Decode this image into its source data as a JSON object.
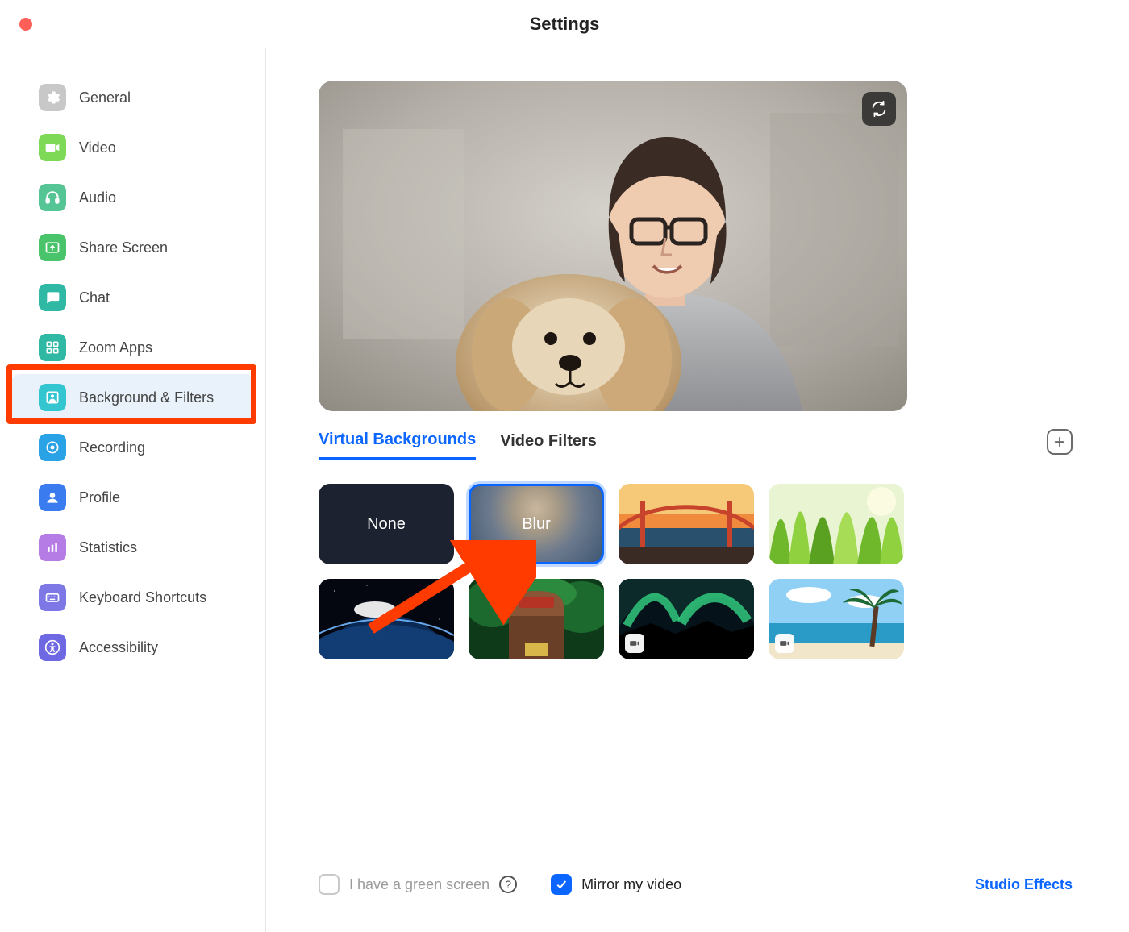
{
  "window": {
    "title": "Settings"
  },
  "sidebar": {
    "items": [
      {
        "label": "General",
        "icon": "gear-icon",
        "color": "#c8c8c8"
      },
      {
        "label": "Video",
        "icon": "video-icon",
        "color": "#7ed957"
      },
      {
        "label": "Audio",
        "icon": "headphones-icon",
        "color": "#56c596"
      },
      {
        "label": "Share Screen",
        "icon": "share-icon",
        "color": "#49c46a"
      },
      {
        "label": "Chat",
        "icon": "chat-icon",
        "color": "#2fb8a3"
      },
      {
        "label": "Zoom Apps",
        "icon": "apps-icon",
        "color": "#2fb8a3"
      },
      {
        "label": "Background & Filters",
        "icon": "bgfilters-icon",
        "color": "#34c6d0",
        "active": true,
        "highlighted": true
      },
      {
        "label": "Recording",
        "icon": "record-icon",
        "color": "#2aa2e6"
      },
      {
        "label": "Profile",
        "icon": "profile-icon",
        "color": "#3a7bf0"
      },
      {
        "label": "Statistics",
        "icon": "stats-icon",
        "color": "#b57ce6"
      },
      {
        "label": "Keyboard Shortcuts",
        "icon": "keyboard-icon",
        "color": "#7e78e6"
      },
      {
        "label": "Accessibility",
        "icon": "accessibility-icon",
        "color": "#6e68e3"
      }
    ]
  },
  "tabs": {
    "virtual_backgrounds": "Virtual Backgrounds",
    "video_filters": "Video Filters",
    "active": "virtual_backgrounds"
  },
  "backgrounds": {
    "none_label": "None",
    "blur_label": "Blur",
    "selected": "blur",
    "tiles": [
      {
        "id": "none",
        "type": "none"
      },
      {
        "id": "blur",
        "type": "blur"
      },
      {
        "id": "bridge",
        "type": "image"
      },
      {
        "id": "grass",
        "type": "image"
      },
      {
        "id": "earth",
        "type": "image"
      },
      {
        "id": "jungle",
        "type": "image"
      },
      {
        "id": "aurora",
        "type": "video"
      },
      {
        "id": "beach",
        "type": "video"
      }
    ]
  },
  "footer": {
    "green_screen_label": "I have a green screen",
    "green_screen_checked": false,
    "mirror_label": "Mirror my video",
    "mirror_checked": true,
    "studio_effects": "Studio Effects"
  },
  "annotation": {
    "arrow_points_to": "blur",
    "sidebar_highlight": "Background & Filters"
  }
}
